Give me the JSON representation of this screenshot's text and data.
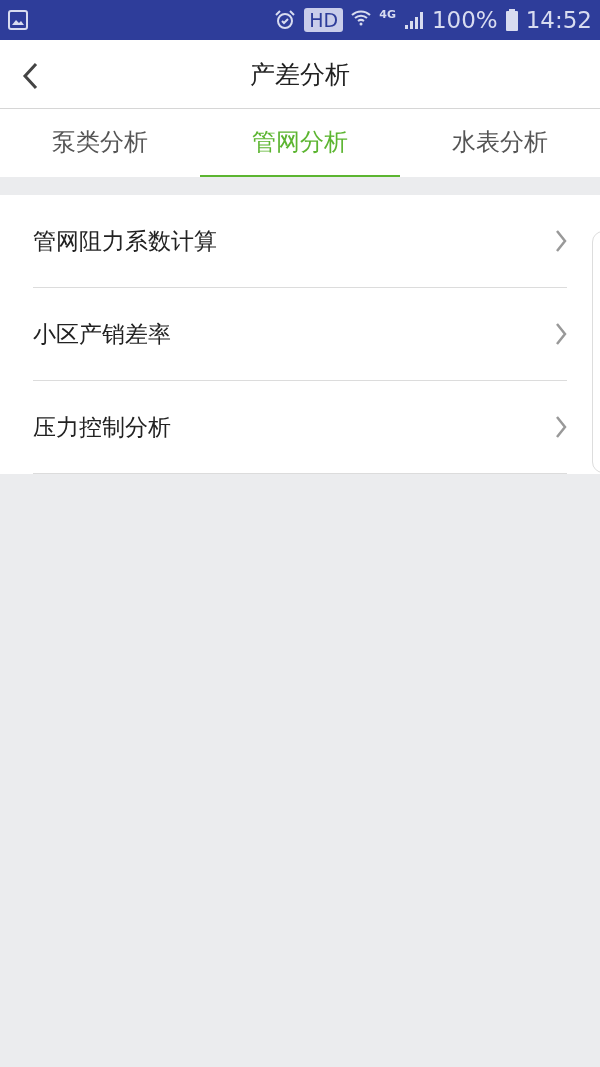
{
  "status_bar": {
    "network": "4G",
    "hd": "HD",
    "battery": "100%",
    "time": "14:52"
  },
  "header": {
    "title": "产差分析"
  },
  "tabs": [
    {
      "label": "泵类分析",
      "selected": false
    },
    {
      "label": "管网分析",
      "selected": true
    },
    {
      "label": "水表分析",
      "selected": false
    }
  ],
  "items": [
    {
      "label": "管网阻力系数计算"
    },
    {
      "label": "小区产销差率"
    },
    {
      "label": "压力控制分析"
    }
  ]
}
